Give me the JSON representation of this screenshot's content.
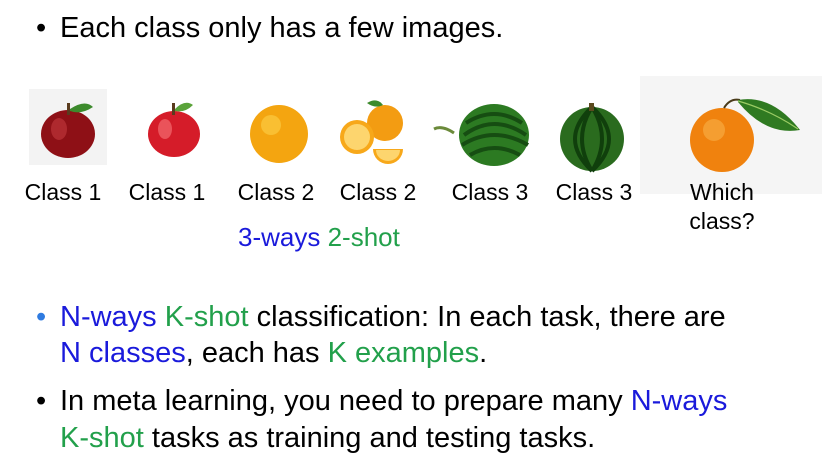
{
  "bullet1": {
    "text": "Each class only has a few images."
  },
  "examples": [
    {
      "fruit": "apple-1",
      "label": "Class 1"
    },
    {
      "fruit": "apple-2",
      "label": "Class 1"
    },
    {
      "fruit": "orange-1",
      "label": "Class 2"
    },
    {
      "fruit": "orange-2",
      "label": "Class 2"
    },
    {
      "fruit": "watermelon-1",
      "label": "Class 3"
    },
    {
      "fruit": "watermelon-2",
      "label": "Class 3"
    }
  ],
  "query": {
    "line1": "Which",
    "line2": "class?"
  },
  "setting": {
    "ways": "3-ways",
    "shot": "2-shot"
  },
  "bullet2": {
    "ways": "N-ways",
    "shot": "K-shot",
    "text1": " classification: In each task, there are",
    "n_classes": "N classes",
    "text2": ", each has ",
    "k_examples": "K examples",
    "text3": "."
  },
  "bullet3": {
    "text1": "In meta learning, you need to prepare many ",
    "ways": "N-ways",
    "shot": "K-shot",
    "text2": " tasks as training and testing tasks."
  },
  "colors": {
    "blue": "#1a1adb",
    "green": "#22a04b",
    "bullet_blue": "#2f7be0"
  }
}
